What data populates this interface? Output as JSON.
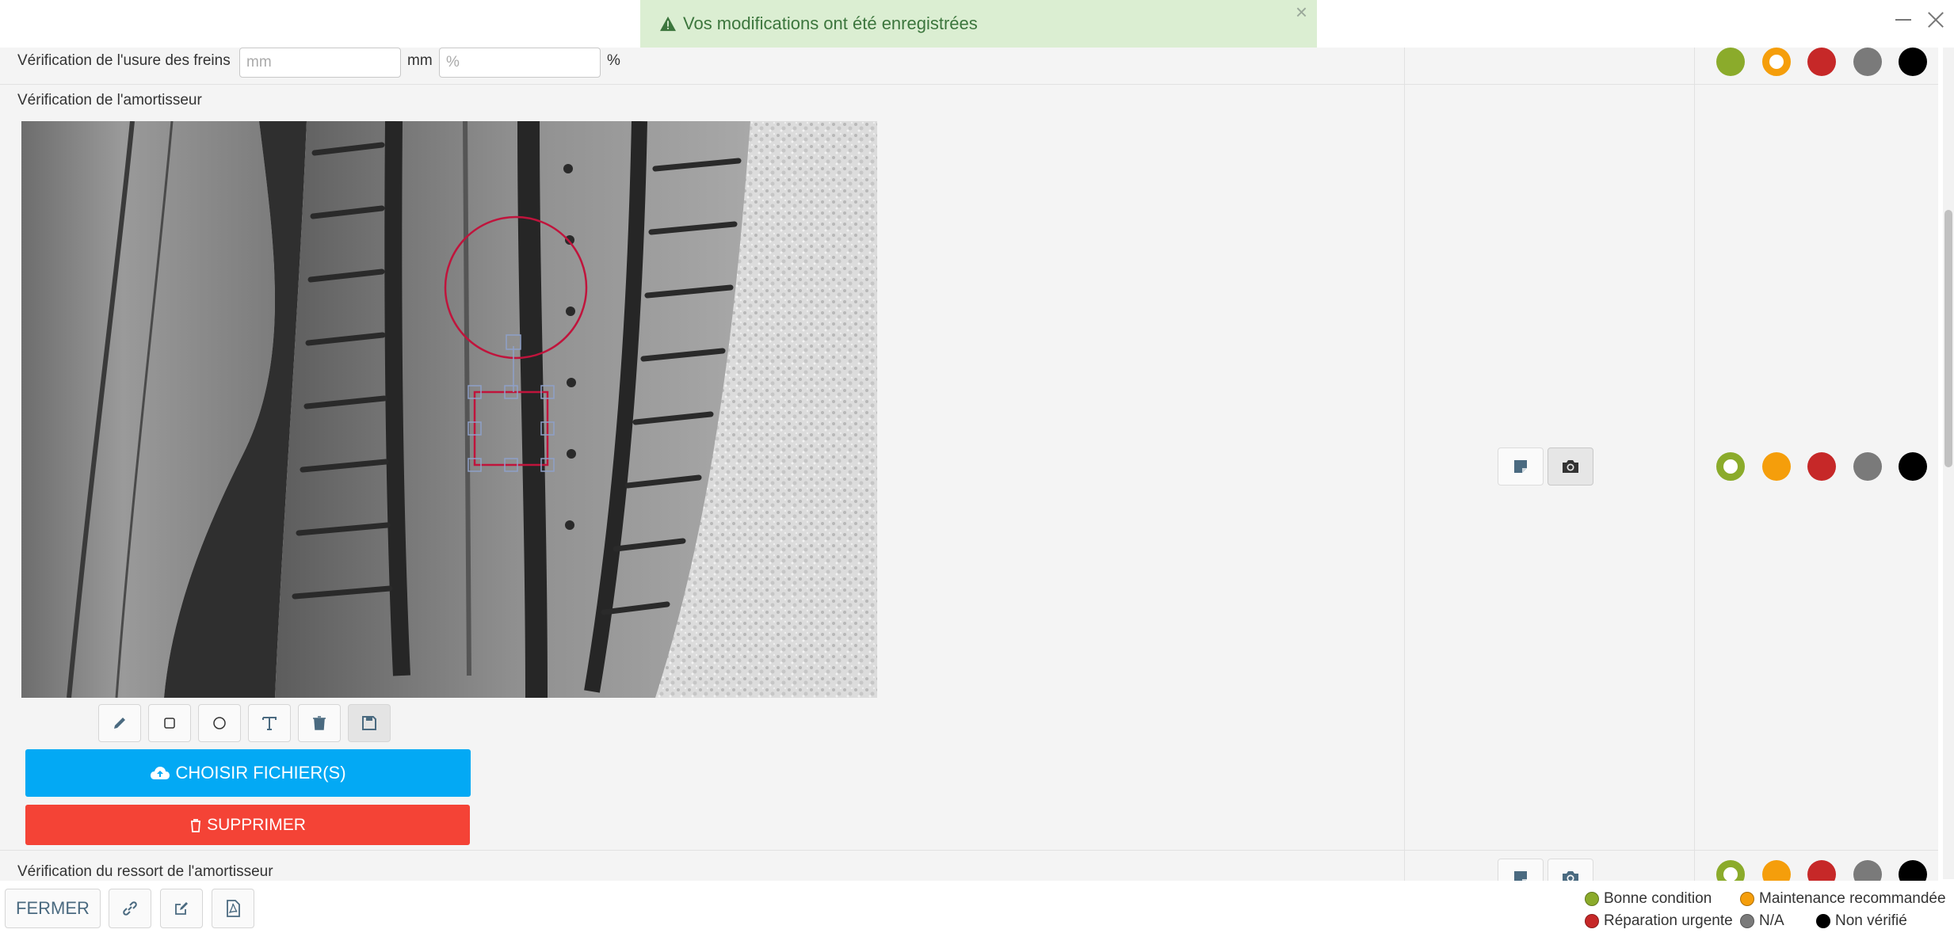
{
  "toast": {
    "message": "Vos modifications ont été enregistrées",
    "close": "×"
  },
  "rows": {
    "brakes": {
      "label": "Vérification de l'usure des freins",
      "mm_placeholder": "mm",
      "mm_unit": "mm",
      "pct_placeholder": "%",
      "pct_unit": "%",
      "selected_status": "Maintenance recommandée"
    },
    "shock": {
      "label": "Vérification de l'amortisseur",
      "selected_status": "Bonne condition"
    },
    "spring": {
      "label": "Vérification du ressort de l'amortisseur",
      "selected_status": "Bonne condition"
    }
  },
  "image_tools": [
    "pencil-icon",
    "rectangle-icon",
    "circle-icon",
    "text-icon",
    "trash-icon",
    "save-icon"
  ],
  "actions": {
    "upload_label": "CHOISIR FICHIER(S)",
    "delete_label": "SUPPRIMER"
  },
  "status_colors": {
    "good": "#8bab2b",
    "maintenance": "#f59e0b",
    "urgent": "#c62828",
    "na": "#7a7a7a",
    "unchecked": "#000000"
  },
  "footer": {
    "close_label": "FERMER"
  },
  "legend": {
    "good": "Bonne condition",
    "maintenance": "Maintenance recommandée",
    "urgent": "Réparation urgente",
    "na": "N/A",
    "unchecked": "Non vérifié"
  }
}
